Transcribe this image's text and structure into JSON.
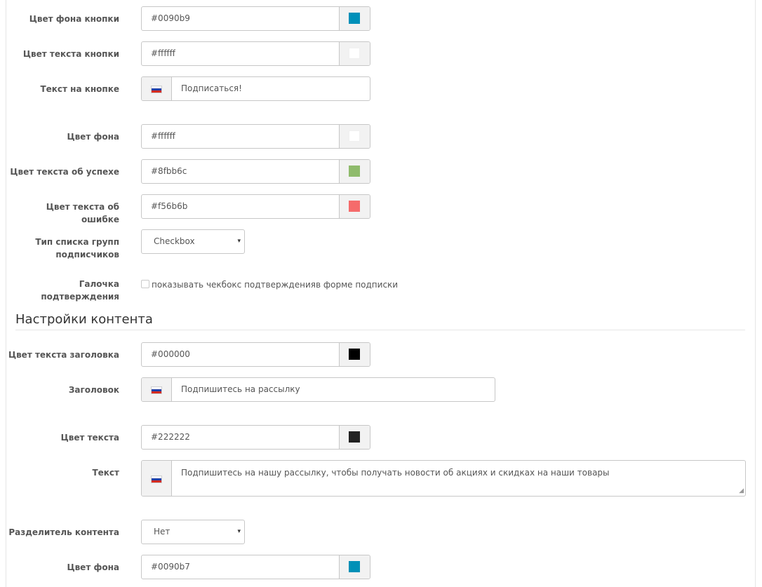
{
  "fields": {
    "btn_bg": {
      "label": "Цвет фона кнопки",
      "value": "#0090b9",
      "swatch": "#0090b9"
    },
    "btn_text_color": {
      "label": "Цвет текста кнопки",
      "value": "#ffffff",
      "swatch": "#ffffff"
    },
    "btn_text": {
      "label": "Текст на кнопке",
      "value": "Подписаться!"
    },
    "bg_color": {
      "label": "Цвет фона",
      "value": "#ffffff",
      "swatch": "#ffffff"
    },
    "success_color": {
      "label": "Цвет текста об успехе",
      "value": "#8fbb6c",
      "swatch": "#8fbb6c"
    },
    "error_color": {
      "label": "Цвет текста об ошибке",
      "value": "#f56b6b",
      "swatch": "#f56b6b"
    },
    "groups_list_type": {
      "label_line1": "Тип списка групп",
      "label_line2": "подписчиков",
      "value": "Checkbox"
    },
    "confirm_checkbox": {
      "label_line1": "Галочка",
      "label_line2": "подтверждения",
      "text": "показывать чекбокс подтвержденияв форме подписки",
      "checked": false
    }
  },
  "content_section": {
    "title": "Настройки контента",
    "title_color": {
      "label": "Цвет текста заголовка",
      "value": "#000000",
      "swatch": "#000000"
    },
    "heading": {
      "label": "Заголовок",
      "value": "Подпишитесь на рассылку"
    },
    "text_color": {
      "label": "Цвет текста",
      "value": "#222222",
      "swatch": "#222222"
    },
    "text": {
      "label": "Текст",
      "value": "Подпишитесь на нашу рассылку, чтобы получать новости об акциях и скидках на наши товары"
    },
    "divider": {
      "label": "Разделитель контента",
      "value": "Нет"
    },
    "bg_color2": {
      "label": "Цвет фона",
      "value": "#0090b7",
      "swatch": "#0090b7"
    }
  },
  "icons": {
    "flag": "ru-flag-icon",
    "select_arrow": "▾",
    "resize": "◢"
  },
  "flag_colors": {
    "white": "#ffffff",
    "blue": "#1c3fa8",
    "red": "#d52b1e"
  }
}
